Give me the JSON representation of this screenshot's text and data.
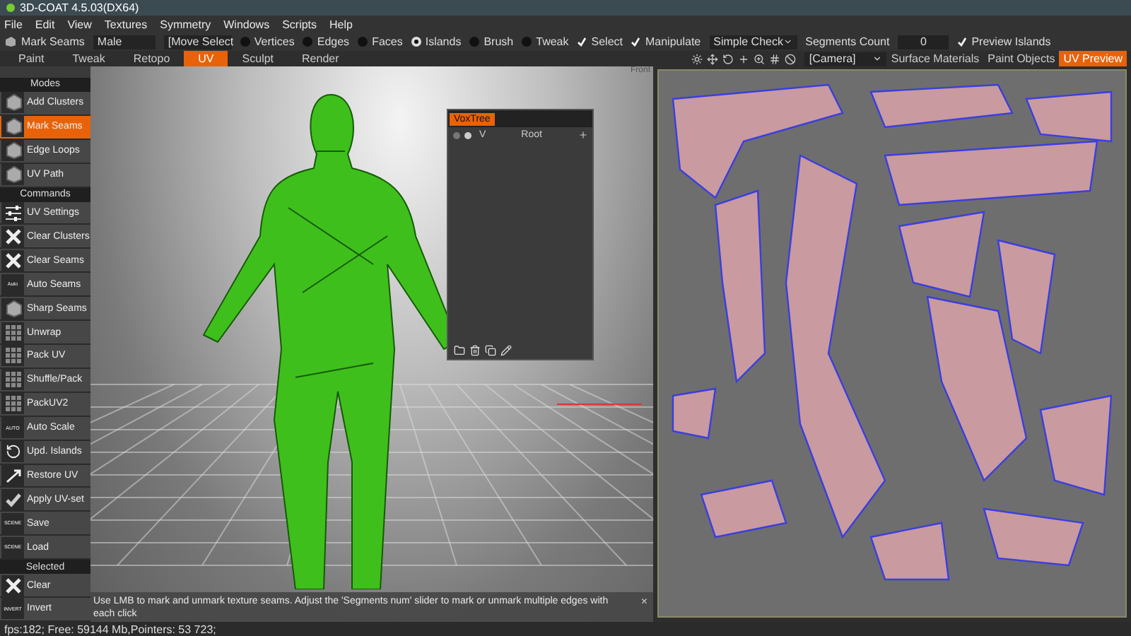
{
  "window": {
    "title": "3D-COAT 4.5.03(DX64)"
  },
  "menu": [
    "File",
    "Edit",
    "View",
    "Textures",
    "Symmetry",
    "Windows",
    "Scripts",
    "Help"
  ],
  "tool_options": {
    "tool_label": "Mark Seams",
    "preset": "Male",
    "move_select": "[Move Select",
    "modes": [
      {
        "label": "Vertices",
        "selected": false
      },
      {
        "label": "Edges",
        "selected": false
      },
      {
        "label": "Faces",
        "selected": false
      },
      {
        "label": "Islands",
        "selected": true
      },
      {
        "label": "Brush",
        "selected": false
      },
      {
        "label": "Tweak",
        "selected": false
      }
    ],
    "checks": [
      {
        "label": "Select",
        "checked": true
      },
      {
        "label": "Manipulate",
        "checked": true
      }
    ],
    "check_mode": "Simple Check",
    "segments_label": "Segments Count",
    "segments_value": "0",
    "preview": {
      "label": "Preview Islands",
      "checked": true
    }
  },
  "rooms": [
    {
      "label": "Paint",
      "selected": false
    },
    {
      "label": "Tweak",
      "selected": false
    },
    {
      "label": "Retopo",
      "selected": false
    },
    {
      "label": "UV",
      "selected": true
    },
    {
      "label": "Sculpt",
      "selected": false
    },
    {
      "label": "Render",
      "selected": false
    }
  ],
  "camera": "[Camera]",
  "right_tabs": [
    {
      "label": "Surface Materials",
      "selected": false
    },
    {
      "label": "Paint Objects",
      "selected": false
    },
    {
      "label": "UV Preview",
      "selected": true
    }
  ],
  "tool_panel": [
    {
      "header": "Modes",
      "items": [
        {
          "label": "Add Clusters",
          "kind": "cube",
          "selected": false
        },
        {
          "label": "Mark Seams",
          "kind": "cube",
          "selected": true
        },
        {
          "label": "Edge Loops",
          "kind": "cube",
          "selected": false
        },
        {
          "label": "UV Path",
          "kind": "cube",
          "selected": false
        }
      ]
    },
    {
      "header": "Commands",
      "items": [
        {
          "label": "UV Settings",
          "kind": "sliders",
          "selected": false
        },
        {
          "label": "Clear Clusters",
          "kind": "cross",
          "selected": false
        },
        {
          "label": "Clear Seams",
          "kind": "cross",
          "selected": false
        },
        {
          "label": "Auto Seams",
          "kind": "text",
          "icon_text": "Auto",
          "selected": false
        },
        {
          "label": "Sharp Seams",
          "kind": "cube",
          "selected": false
        },
        {
          "label": "Unwrap",
          "kind": "grid",
          "selected": false
        },
        {
          "label": "Pack UV",
          "kind": "grid",
          "selected": false
        },
        {
          "label": "Shuffle/Pack",
          "kind": "grid",
          "selected": false
        },
        {
          "label": "PackUV2",
          "kind": "grid",
          "selected": false
        },
        {
          "label": "Auto Scale",
          "kind": "text",
          "icon_text": "AUTO",
          "selected": false
        },
        {
          "label": "Upd. Islands",
          "kind": "refresh",
          "selected": false
        },
        {
          "label": "Restore UV",
          "kind": "restore",
          "selected": false
        },
        {
          "label": "Apply UV-set",
          "kind": "check",
          "selected": false
        },
        {
          "label": "Save",
          "kind": "text",
          "icon_text": "SCENE",
          "selected": false
        },
        {
          "label": "Load",
          "kind": "text",
          "icon_text": "SCENE",
          "selected": false
        }
      ]
    },
    {
      "header": "Selected",
      "items": [
        {
          "label": "Clear",
          "kind": "cross",
          "selected": false
        },
        {
          "label": "Invert",
          "kind": "text",
          "icon_text": "INVERT",
          "selected": false
        }
      ]
    }
  ],
  "viewport": {
    "view_label": "Front",
    "hint": "Use LMB to mark and unmark texture seams. Adjust the 'Segments num' slider to mark or unmark multiple edges with each click",
    "close": "×"
  },
  "voxtree": {
    "title": "VoxTree",
    "row": {
      "visible": "V",
      "name": "Root"
    }
  },
  "status_bar": "fps:182;  Free: 59144 Mb,Pointers: 53 723;"
}
